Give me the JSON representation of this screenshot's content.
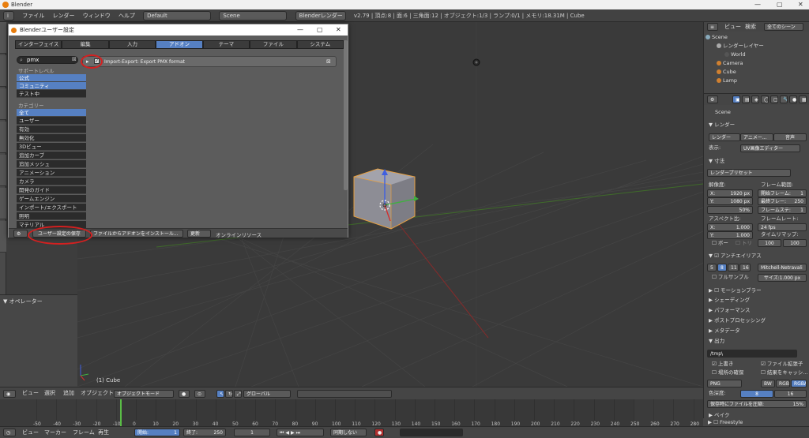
{
  "window": {
    "title": "Blender"
  },
  "infobar": {
    "menus": [
      "ファイル",
      "レンダー",
      "ウィンドウ",
      "ヘルプ"
    ],
    "layout": "Default",
    "scene": "Scene",
    "engine": "Blenderレンダー",
    "stats": "v2.79 | 頂点:8 | 面:6 | 三角面:12 | オブジェクト:1/3 | ランプ:0/1 | メモリ:18.31M | Cube"
  },
  "prefs": {
    "title": "Blenderユーザー設定",
    "tabs": [
      "インターフェイス",
      "編集",
      "入力",
      "アドオン",
      "テーマ",
      "ファイル",
      "システム"
    ],
    "active_tab": 3,
    "search_value": "pmx",
    "support_label": "サポートレベル",
    "support": [
      "公式",
      "コミュニティ",
      "テスト中"
    ],
    "category_label": "カテゴリー",
    "categories": [
      "全て",
      "ユーザー",
      "有効",
      "無効化",
      "3Dビュー",
      "追加カーブ",
      "追加メッシュ",
      "アニメーション",
      "カメラ",
      "開発のガイド",
      "ゲームエンジン",
      "インポート/エクスポート",
      "照明",
      "マテリアル"
    ],
    "addon_name": "Import-Export: Export PMX format",
    "save_button": "ユーザー設定の保存",
    "install_button": "ファイルからアドオンをインストール...",
    "refresh_button": "更新",
    "online_button": "オンラインリソース"
  },
  "operator": {
    "label": "▼ オペレーター"
  },
  "viewport": {
    "object_label": "(1) Cube"
  },
  "vheader": {
    "items": [
      "ビュー",
      "選択",
      "追加",
      "オブジェクト"
    ],
    "mode": "オブジェクトモード",
    "orient": "グローバル"
  },
  "timeline": {
    "ticks": [
      "-50",
      "-40",
      "-30",
      "-20",
      "-10",
      "0",
      "10",
      "20",
      "30",
      "40",
      "50",
      "60",
      "70",
      "80",
      "90",
      "100",
      "110",
      "120",
      "130",
      "140",
      "150",
      "160",
      "170",
      "180",
      "190",
      "200",
      "210",
      "220",
      "230",
      "240",
      "250",
      "260",
      "270",
      "280"
    ]
  },
  "tlheader": {
    "items": [
      "ビュー",
      "マーカー",
      "フレーム",
      "再生"
    ],
    "start": "開始:",
    "start_val": "1",
    "end": "終了:",
    "end_val": "250",
    "current": "1",
    "sync": "同期しない"
  },
  "outliner": {
    "menu": [
      "ビュー",
      "検索"
    ],
    "filter": "全てのシーン",
    "rows": [
      "Scene",
      "レンダーレイヤー",
      "World",
      "Camera",
      "Cube",
      "Lamp"
    ]
  },
  "properties": {
    "scene_crumb": "Scene",
    "render_panel": "レンダー",
    "render_btn": "レンダー",
    "anim_btn": "アニメー...",
    "audio_btn": "音声",
    "display_label": "表示:",
    "display_val": "UV画像エディター",
    "dims_panel": "寸法",
    "preset": "レンダープリセット",
    "resolution": "解像度:",
    "res_x": "X:",
    "res_x_val": "1920 px",
    "res_y": "Y:",
    "res_y_val": "1080 px",
    "res_pct": "50%",
    "frame_range": "フレーム範囲:",
    "start_frame": "開始フレーム:",
    "start_frame_val": "1",
    "end_frame": "最終フレー:",
    "end_frame_val": "250",
    "frame_step": "フレームステ:",
    "frame_step_val": "1",
    "aspect": "アスペクト比:",
    "asp_x": "X:",
    "asp_x_val": "1.000",
    "asp_y": "Y:",
    "asp_y_val": "1.000",
    "frame_rate": "フレームレート:",
    "fps": "24 fps",
    "time_remap": "タイムリマップ:",
    "remap_old": "100",
    "remap_new": "100",
    "border": "ボー",
    "crop": "トリ",
    "aa_panel": "アンチエイリアス",
    "aa_samples": [
      "5",
      "8",
      "11",
      "16"
    ],
    "aa_filter": "Mitchell-Netravali",
    "full_sample": "フルサンプル",
    "size_label": "サイズ:1.000 px",
    "panels": [
      "モーションブラー",
      "シェーディング",
      "パフォーマンス",
      "ポストプロセッシング",
      "メタデータ"
    ],
    "output_panel": "出力",
    "output_path": "/tmp\\",
    "overwrite": "上書き",
    "file_ext": "ファイル拡張子",
    "placeholders": "場所の確保",
    "cache_result": "結果をキャッシ...",
    "format": "PNG",
    "bw": "BW",
    "rgb": "RGB",
    "rgba": "RGBA",
    "color_depth_label": "色深度:",
    "depth8": "8",
    "depth16": "16",
    "compress_label": "保存時にファイルを圧縮:",
    "compress_val": "15%",
    "bake_panel": "ベイク",
    "freestyle_panel": "Freestyle"
  }
}
